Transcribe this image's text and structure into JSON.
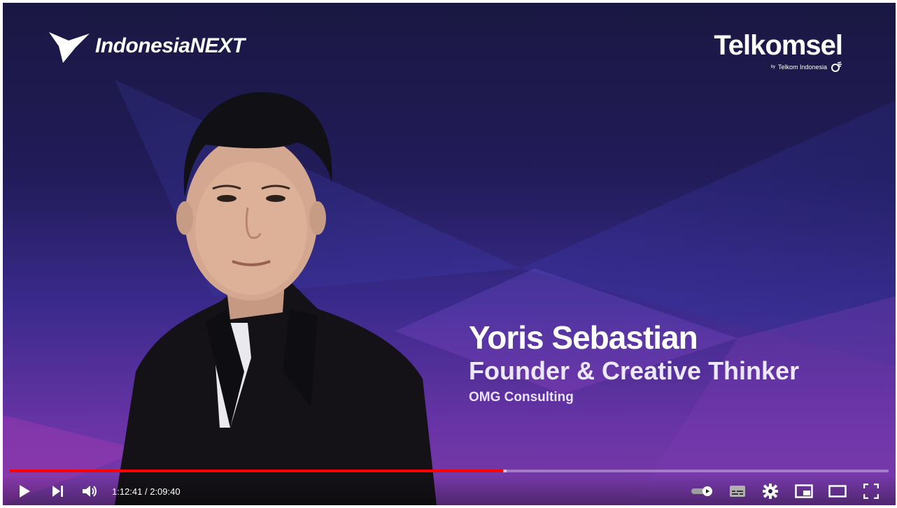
{
  "brand": {
    "left_logo_text": "IndonesiaNEXT",
    "right_logo_text": "Telkomsel",
    "right_logo_sub_by": "by",
    "right_logo_sub_text": "Telkom Indonesia"
  },
  "caption": {
    "name": "Yoris Sebastian",
    "role": "Founder & Creative Thinker",
    "organization": "OMG Consulting"
  },
  "player": {
    "current_time": "1:12:41",
    "separator": " / ",
    "duration": "2:09:40",
    "progress_fraction": 0.561,
    "buffered_fraction": 0.565,
    "accent_color": "#ff0000",
    "left_controls": [
      "play-icon",
      "next-icon",
      "volume-icon"
    ],
    "right_controls": [
      "autoplay-toggle",
      "subtitles-icon",
      "settings-gear-icon",
      "miniplayer-icon",
      "theater-mode-icon",
      "fullscreen-icon"
    ]
  }
}
